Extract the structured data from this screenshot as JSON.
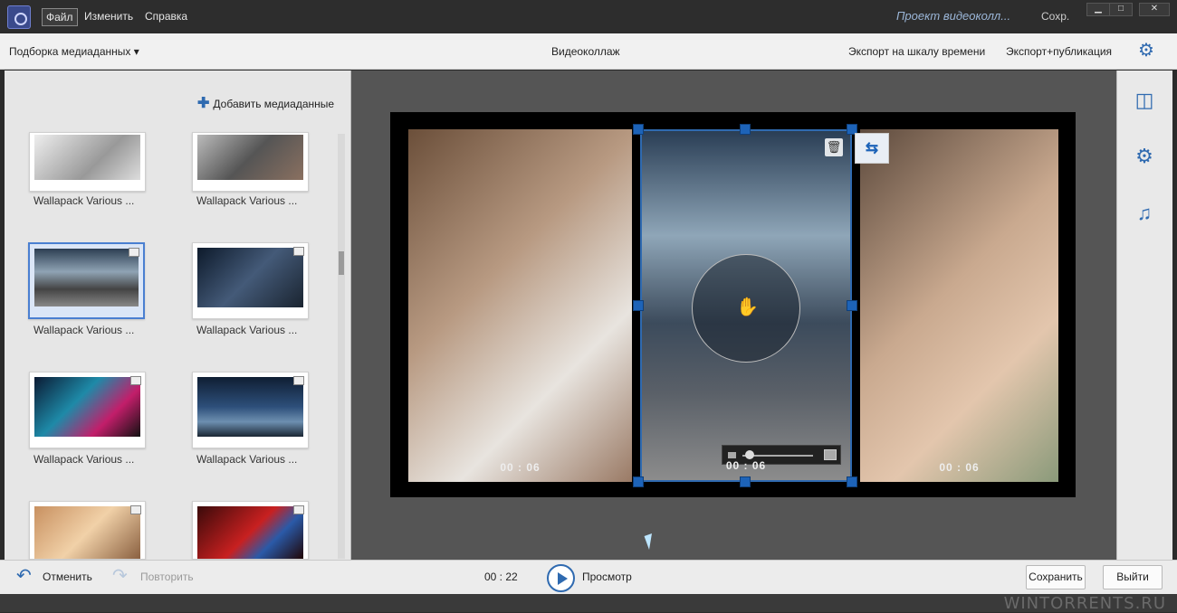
{
  "titlebar": {
    "menus": [
      "Файл",
      "Изменить",
      "Справка"
    ],
    "project_title": "Проект видеоколл...",
    "saved_label": "Сохр."
  },
  "toolbar": {
    "media_selection": "Подборка медиаданных ▾",
    "center_title": "Видеоколлаж",
    "export_timeline": "Экспорт на шкалу времени",
    "export_publish": "Экспорт+публикация",
    "settings_icon": "gear-icon"
  },
  "media": {
    "add_media_label": "Добавить медиаданные",
    "items": [
      {
        "label": "Wallapack Various ...",
        "selected": false
      },
      {
        "label": "Wallapack Various ...",
        "selected": false
      },
      {
        "label": "Wallapack Various ...",
        "selected": true
      },
      {
        "label": "Wallapack Various ...",
        "selected": false
      },
      {
        "label": "Wallapack Various ...",
        "selected": false
      },
      {
        "label": "Wallapack Various ...",
        "selected": false
      },
      {
        "label": "",
        "selected": false
      },
      {
        "label": "",
        "selected": false
      }
    ]
  },
  "collage": {
    "frames": [
      {
        "time": "00 : 06"
      },
      {
        "time": "00 : 06"
      },
      {
        "time": "00 : 06"
      }
    ]
  },
  "right_panel": {
    "icons": [
      "layout-icon",
      "gear-play-icon",
      "music-note-icon"
    ]
  },
  "bottombar": {
    "undo_label": "Отменить",
    "redo_label": "Повторить",
    "duration": "00 : 22",
    "preview_label": "Просмотр",
    "save_label": "Сохранить",
    "exit_label": "Выйти"
  },
  "watermark": "WINTORRENTS.RU",
  "colors": {
    "accent": "#2f6ab0",
    "titlebar_bg": "#2d2d2d",
    "stage_bg": "#555555"
  }
}
